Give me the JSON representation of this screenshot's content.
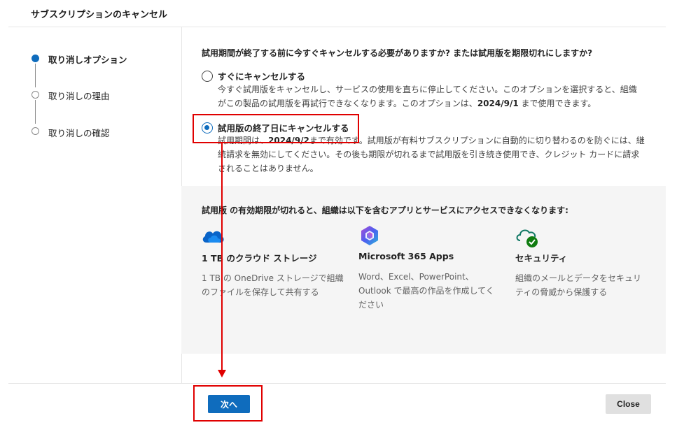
{
  "header": {
    "title": "サブスクリプションのキャンセル"
  },
  "stepper": {
    "steps": [
      {
        "label": "取り消しオプション",
        "state": "active"
      },
      {
        "label": "取り消しの理由",
        "state": "inactive"
      },
      {
        "label": "取り消しの確認",
        "state": "inactive"
      }
    ]
  },
  "main": {
    "question": "試用期間が終了する前に今すぐキャンセルする必要がありますか? または試用版を期限切れにしますか?",
    "options": [
      {
        "title": "すぐにキャンセルする",
        "desc_line1": "今すぐ試用版をキャンセルし、サービスの使用を直ちに停止してください。このオプションを選択すると、組織",
        "desc_line2_a": "がこの製品の試用版を再試行できなくなります。このオプションは、",
        "desc_line2_date": "2024/9/1",
        "desc_line2_b": " まで使用できます。",
        "checked": false
      },
      {
        "title": "試用版の終了日にキャンセルする",
        "desc_line1_a": "試用期間は、",
        "desc_line1_date": "2024/9/2",
        "desc_line1_b": "まで有効です。試用版が有料サブスクリプションに自動的に切り替わるのを防ぐには、継",
        "desc_line2": "続請求を無効にしてください。その後も期限が切れるまで試用版を引き続き使用でき、クレジット カードに請求",
        "desc_line3": "されることはありません。",
        "checked": true
      }
    ]
  },
  "panel": {
    "title": "試用版 の有効期限が切れると、組織は以下を含むアプリとサービスにアクセスできなくなります:",
    "features": [
      {
        "icon": "onedrive-cloud-icon",
        "title": "1 TB のクラウド ストレージ",
        "desc_line1": "1 TB の OneDrive ストレージで組織",
        "desc_line2": "のファイルを保存して共有する"
      },
      {
        "icon": "microsoft365-icon",
        "title": "Microsoft 365 Apps",
        "desc_line1": "Word、Excel、PowerPoint、",
        "desc_line2": "Outlook で最高の作品を作成してく",
        "desc_line3": "ださい"
      },
      {
        "icon": "security-cloud-check-icon",
        "title": "セキュリティ",
        "desc_line1": "組織のメールとデータをセキュリ",
        "desc_line2": "ティの脅威から保護する"
      }
    ]
  },
  "footer": {
    "next_label": "次へ",
    "close_label": "Close"
  },
  "colors": {
    "accent": "#0f6cbd",
    "annotation": "#e00000",
    "panel_bg": "#f5f5f5"
  }
}
